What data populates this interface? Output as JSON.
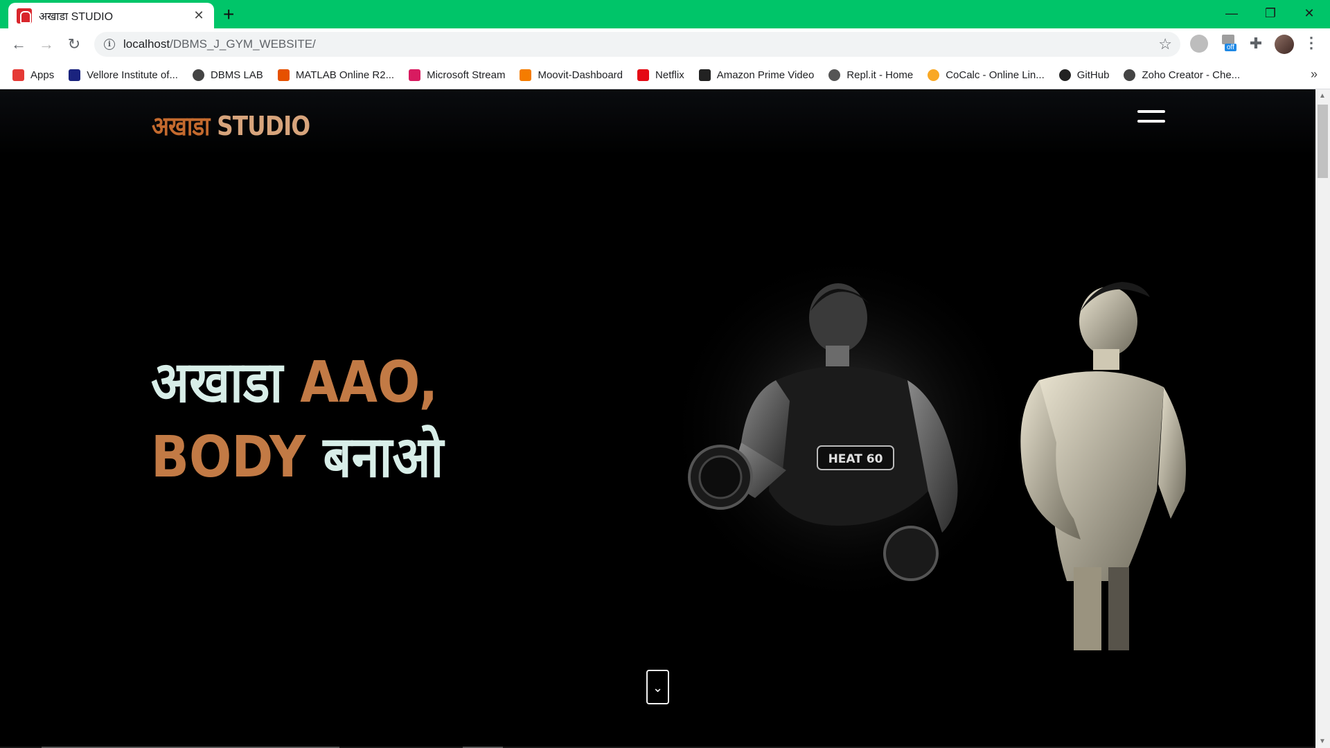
{
  "browser": {
    "tab_title": "अखाडा STUDIO",
    "tab_close": "✕",
    "new_tab": "+",
    "url_host": "localhost",
    "url_path": "/DBMS_J_GYM_WEBSITE/",
    "window_controls": {
      "minimize": "—",
      "maximize": "❐",
      "close": "✕"
    },
    "theme_color": "#00c569",
    "extension_badge": "off",
    "bookmarks_more": "»"
  },
  "bookmarks": [
    {
      "label": "Apps",
      "icon": "apps-grid-icon",
      "color": "#e53935"
    },
    {
      "label": "Vellore Institute of...",
      "icon": "vit-icon",
      "color": "#1a237e"
    },
    {
      "label": "DBMS LAB",
      "icon": "globe-icon",
      "color": "#444444"
    },
    {
      "label": "MATLAB Online R2...",
      "icon": "matlab-icon",
      "color": "#e65100"
    },
    {
      "label": "Microsoft Stream",
      "icon": "stream-icon",
      "color": "#d81b60"
    },
    {
      "label": "Moovit-Dashboard",
      "icon": "moovit-icon",
      "color": "#f57c00"
    },
    {
      "label": "Netflix",
      "icon": "netflix-icon",
      "color": "#e50914"
    },
    {
      "label": "Amazon Prime Video",
      "icon": "amazon-icon",
      "color": "#222222"
    },
    {
      "label": "Repl.it - Home",
      "icon": "replit-icon",
      "color": "#555555"
    },
    {
      "label": "CoCalc - Online Lin...",
      "icon": "cocalc-icon",
      "color": "#f9a825"
    },
    {
      "label": "GitHub",
      "icon": "github-icon",
      "color": "#222222"
    },
    {
      "label": "Zoho Creator - Che...",
      "icon": "globe-icon",
      "color": "#444444"
    }
  ],
  "site": {
    "logo_hindi": "अखाडा",
    "logo_english": "STUDIO",
    "hero_line1_a": "अखाडा",
    "hero_line1_b": "AAO,",
    "hero_line2_a": "BODY",
    "hero_line2_b": "बनाओ",
    "shirt_text": "HEAT 60",
    "scroll_down": "⌄",
    "colors": {
      "accent": "#c27a45",
      "light": "#d8eee8",
      "logo_hindi": "#c46a2e"
    }
  }
}
